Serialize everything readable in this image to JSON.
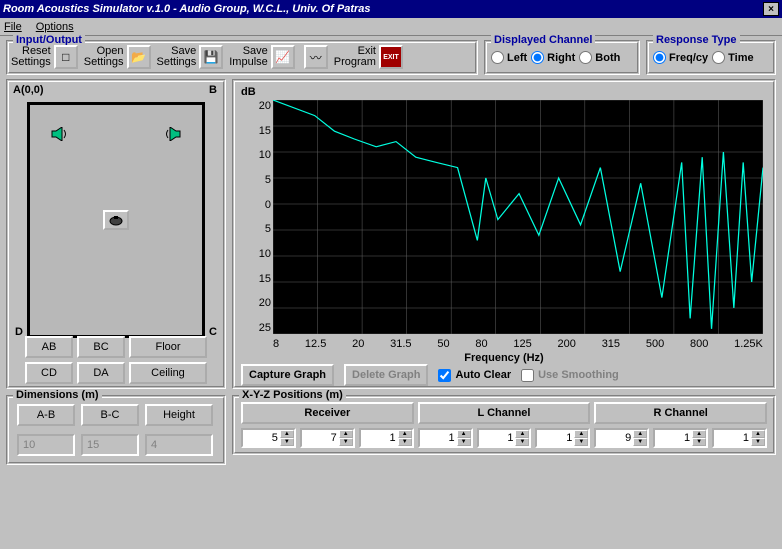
{
  "window": {
    "title": "Room Acoustics Simulator v.1.0 -  Audio Group, W.C.L., Univ. Of Patras"
  },
  "menu": {
    "file": "File",
    "options": "Options"
  },
  "io": {
    "title": "Input/Output",
    "reset": "Reset\nSettings",
    "open": "Open\nSettings",
    "save": "Save\nSettings",
    "saveimp": "Save\nImpulse",
    "blank": "",
    "exit": "Exit\nProgram"
  },
  "disp": {
    "title": "Displayed Channel",
    "left": "Left",
    "right": "Right",
    "both": "Both",
    "selected": "Right"
  },
  "resp": {
    "title": "Response Type",
    "freq": "Freq/cy",
    "time": "Time",
    "selected": "Freq/cy"
  },
  "room": {
    "A": "A(0,0)",
    "B": "B",
    "C": "C",
    "D": "D",
    "walls": {
      "AB": "AB",
      "BC": "BC",
      "CD": "CD",
      "DA": "DA",
      "floor": "Floor",
      "ceiling": "Ceiling"
    }
  },
  "dims": {
    "title": "Dimensions (m)",
    "ab": "A-B",
    "bc": "B-C",
    "h": "Height",
    "vab": "10",
    "vbc": "15",
    "vh": "4"
  },
  "chart": {
    "ylabel": "dB",
    "yticks": [
      "20",
      "15",
      "10",
      "5",
      "0",
      "5",
      "10",
      "15",
      "20",
      "25"
    ],
    "xticks": [
      "8",
      "12.5",
      "20",
      "31.5",
      "50",
      "80",
      "125",
      "200",
      "315",
      "500",
      "800",
      "1.25K"
    ],
    "xlabel": "Frequency (Hz)",
    "capture": "Capture Graph",
    "delete": "Delete Graph",
    "autoclear": "Auto Clear",
    "smooth": "Use Smoothing",
    "autoclear_checked": true,
    "smooth_checked": false
  },
  "pos": {
    "title": "X-Y-Z Positions (m)",
    "recv": "Receiver",
    "l": "L Channel",
    "r": "R Channel",
    "rv": [
      "5",
      "7",
      "1"
    ],
    "lv": [
      "1",
      "1",
      "1"
    ],
    "rrv": [
      "9",
      "1",
      "1"
    ]
  },
  "chart_data": {
    "type": "line",
    "title": "",
    "xlabel": "Frequency (Hz)",
    "ylabel": "dB",
    "ylim": [
      -25,
      20
    ],
    "x": [
      5,
      8,
      10,
      12.5,
      16,
      20,
      25,
      31.5,
      40,
      50,
      55,
      63,
      80,
      100,
      125,
      160,
      200,
      250,
      315,
      400,
      500,
      550,
      630,
      700,
      800,
      900,
      1000,
      1100,
      1250
    ],
    "series": [
      {
        "name": "Right",
        "values": [
          20,
          17,
          14,
          12.5,
          11,
          12,
          9,
          8,
          7,
          -7,
          5,
          -3,
          2,
          -6,
          5,
          -4,
          7,
          -13,
          4,
          -18,
          8,
          -22,
          9,
          -24,
          10,
          -20,
          8,
          -15,
          7
        ]
      }
    ]
  }
}
